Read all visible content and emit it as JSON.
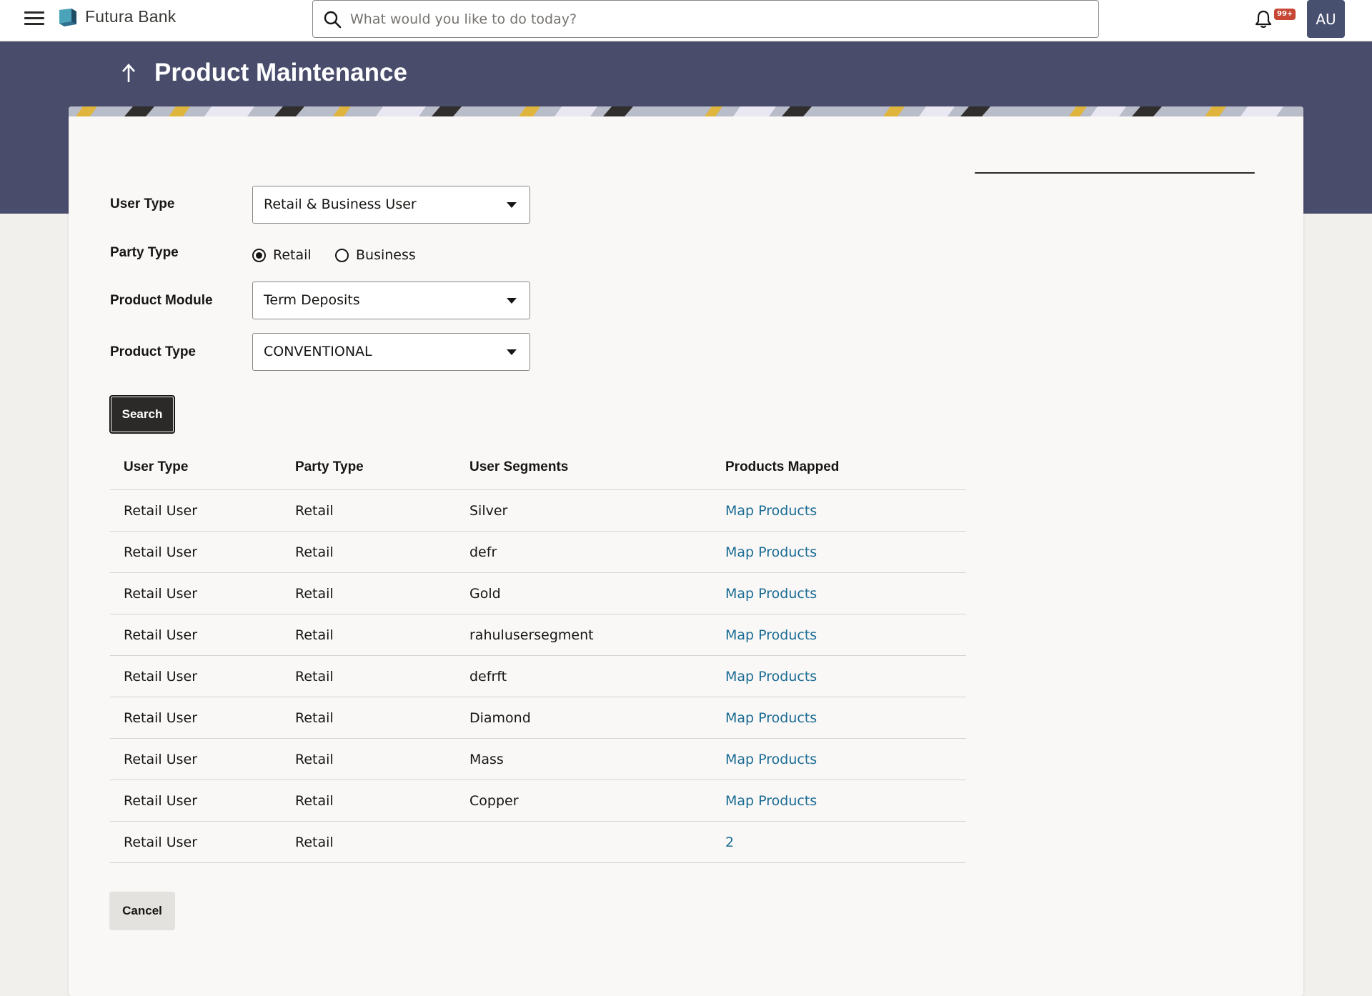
{
  "header": {
    "brand": "Futura Bank",
    "search_placeholder": "What would you like to do today?",
    "notification_count": "99+",
    "avatar_initials": "AU"
  },
  "page": {
    "title": "Product Maintenance"
  },
  "form": {
    "user_type_label": "User Type",
    "user_type_value": "Retail & Business User",
    "party_type_label": "Party Type",
    "party_type_options": [
      "Retail",
      "Business"
    ],
    "party_type_selected": "Retail",
    "product_module_label": "Product Module",
    "product_module_value": "Term Deposits",
    "product_type_label": "Product Type",
    "product_type_value": "CONVENTIONAL",
    "search_label": "Search"
  },
  "table": {
    "headers": [
      "User Type",
      "Party Type",
      "User Segments",
      "Products Mapped"
    ],
    "rows": [
      [
        "Retail User",
        "Retail",
        "Silver",
        "Map Products"
      ],
      [
        "Retail User",
        "Retail",
        "defr",
        "Map Products"
      ],
      [
        "Retail User",
        "Retail",
        "Gold",
        "Map Products"
      ],
      [
        "Retail User",
        "Retail",
        "rahulusersegment",
        "Map Products"
      ],
      [
        "Retail User",
        "Retail",
        "defrft",
        "Map Products"
      ],
      [
        "Retail User",
        "Retail",
        "Diamond",
        "Map Products"
      ],
      [
        "Retail User",
        "Retail",
        "Mass",
        "Map Products"
      ],
      [
        "Retail User",
        "Retail",
        "Copper",
        "Map Products"
      ],
      [
        "Retail User",
        "Retail",
        "",
        "2"
      ]
    ]
  },
  "actions": {
    "cancel_label": "Cancel"
  },
  "colors": {
    "banner": "#494d6b",
    "link": "#1a6b94",
    "primary_button": "#2b2a28",
    "badge": "#c74634"
  }
}
